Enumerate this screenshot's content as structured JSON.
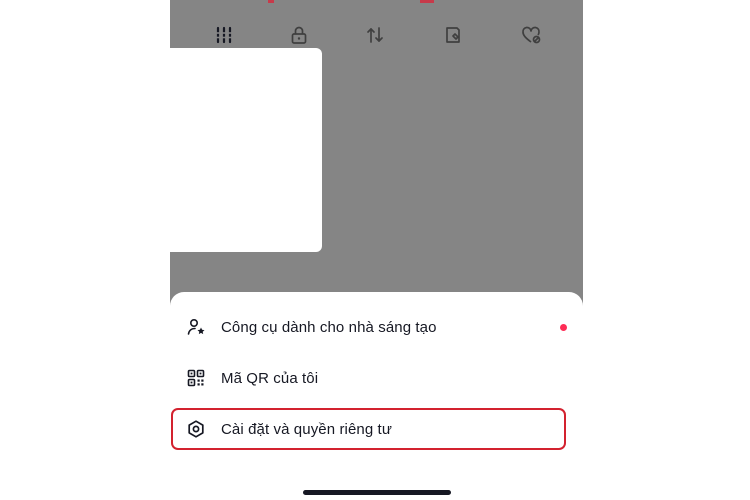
{
  "colors": {
    "accent_red": "#d3222f",
    "notification_dot": "#fe2c55",
    "text": "#161823",
    "dim_overlay": "#858585"
  },
  "tabs": [
    {
      "icon": "grid-icon"
    },
    {
      "icon": "lock-icon"
    },
    {
      "icon": "repost-icon"
    },
    {
      "icon": "bookmark-icon"
    },
    {
      "icon": "heart-icon"
    }
  ],
  "sheet": {
    "items": [
      {
        "icon": "creator-star-icon",
        "label": "Công cụ dành cho nhà sáng tạo",
        "has_dot": true
      },
      {
        "icon": "qr-code-icon",
        "label": "Mã QR của tôi",
        "has_dot": false
      },
      {
        "icon": "settings-gear-icon",
        "label": "Cài đặt và quyền riêng tư",
        "highlighted": true
      }
    ]
  }
}
